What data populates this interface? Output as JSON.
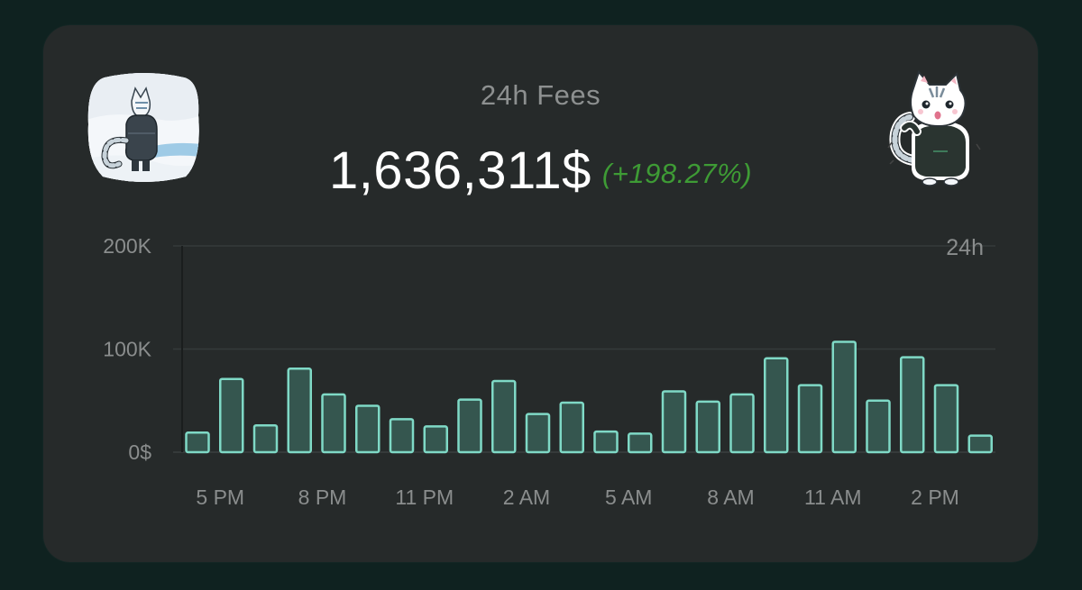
{
  "header": {
    "title": "24h Fees",
    "amount": "1,636,311$",
    "change": "(+198.27%)"
  },
  "images": {
    "left_sticker": "cat-in-snow-sticker",
    "right_sticker": "surprised-cat-sticker"
  },
  "colors": {
    "background": "#0f2220",
    "card": "#262a2a",
    "bar_fill": "#35564f",
    "bar_stroke": "#7fd9c6",
    "positive": "#3e9b35"
  },
  "chart_data": {
    "type": "bar",
    "period_label": "24h",
    "y_tick_labels": [
      "0$",
      "100K",
      "200K"
    ],
    "y_ticks": [
      0,
      100000,
      200000
    ],
    "ylim": [
      0,
      200000
    ],
    "x_tick_labels": [
      "5 PM",
      "8 PM",
      "11 PM",
      "2 AM",
      "5 AM",
      "8 AM",
      "11 AM",
      "2 PM"
    ],
    "x_tick_index": [
      1,
      4,
      7,
      10,
      13,
      16,
      19,
      22
    ],
    "grid": true,
    "values": [
      19000,
      71000,
      26000,
      81000,
      56000,
      45000,
      32000,
      25000,
      51000,
      69000,
      37000,
      48000,
      20000,
      18000,
      59000,
      49000,
      56000,
      91000,
      65000,
      107000,
      50000,
      92000,
      65000,
      16000
    ]
  }
}
